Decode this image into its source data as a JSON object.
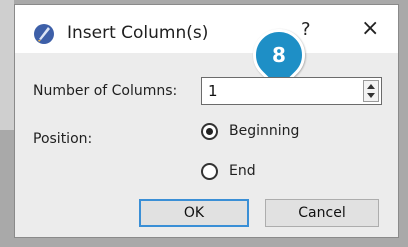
{
  "dialog": {
    "title": "Insert Column(s)",
    "help_label": "?",
    "close_label": "×"
  },
  "callout": {
    "number": "8"
  },
  "fields": {
    "columns_label": "Number of Columns:",
    "columns_value": "1",
    "position_label": "Position:"
  },
  "position_options": [
    {
      "label": "Beginning",
      "selected": true
    },
    {
      "label": "End",
      "selected": false
    }
  ],
  "buttons": {
    "ok_label": "OK",
    "cancel_label": "Cancel"
  },
  "colors": {
    "callout": "#1e8fc6",
    "ok_focus": "#3a8fd6"
  }
}
